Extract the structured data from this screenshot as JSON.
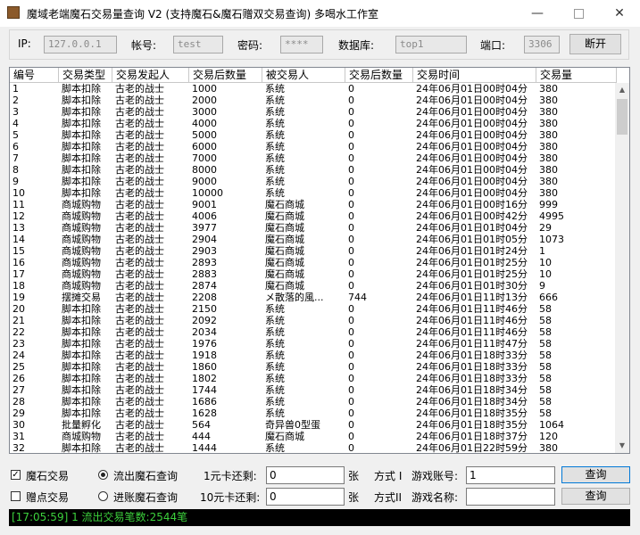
{
  "window": {
    "title": "魔域老端魔石交易量查询 V2 (支持魔石&魔石赠双交易查询) 多喝水工作室"
  },
  "connection": {
    "ip_label": "IP:",
    "ip_value": "127.0.0.1",
    "account_label": "帐号:",
    "account_value": "test",
    "password_label": "密码:",
    "password_value": "****",
    "database_label": "数据库:",
    "database_value": "top1",
    "port_label": "端口:",
    "port_value": "3306",
    "disconnect_label": "断开"
  },
  "table": {
    "columns": [
      "编号",
      "交易类型",
      "交易发起人",
      "交易后数量",
      "被交易人",
      "交易后数量",
      "交易时间",
      "交易量"
    ],
    "rows": [
      [
        "1",
        "脚本扣除",
        "古老的战士",
        "1000",
        "系统",
        "0",
        "24年06月01日00时04分",
        "380"
      ],
      [
        "2",
        "脚本扣除",
        "古老的战士",
        "2000",
        "系统",
        "0",
        "24年06月01日00时04分",
        "380"
      ],
      [
        "3",
        "脚本扣除",
        "古老的战士",
        "3000",
        "系统",
        "0",
        "24年06月01日00时04分",
        "380"
      ],
      [
        "4",
        "脚本扣除",
        "古老的战士",
        "4000",
        "系统",
        "0",
        "24年06月01日00时04分",
        "380"
      ],
      [
        "5",
        "脚本扣除",
        "古老的战士",
        "5000",
        "系统",
        "0",
        "24年06月01日00时04分",
        "380"
      ],
      [
        "6",
        "脚本扣除",
        "古老的战士",
        "6000",
        "系统",
        "0",
        "24年06月01日00时04分",
        "380"
      ],
      [
        "7",
        "脚本扣除",
        "古老的战士",
        "7000",
        "系统",
        "0",
        "24年06月01日00时04分",
        "380"
      ],
      [
        "8",
        "脚本扣除",
        "古老的战士",
        "8000",
        "系统",
        "0",
        "24年06月01日00时04分",
        "380"
      ],
      [
        "9",
        "脚本扣除",
        "古老的战士",
        "9000",
        "系统",
        "0",
        "24年06月01日00时04分",
        "380"
      ],
      [
        "10",
        "脚本扣除",
        "古老的战士",
        "10000",
        "系统",
        "0",
        "24年06月01日00时04分",
        "380"
      ],
      [
        "11",
        "商城购物",
        "古老的战士",
        "9001",
        "魔石商城",
        "0",
        "24年06月01日00时16分",
        "999"
      ],
      [
        "12",
        "商城购物",
        "古老的战士",
        "4006",
        "魔石商城",
        "0",
        "24年06月01日00时42分",
        "4995"
      ],
      [
        "13",
        "商城购物",
        "古老的战士",
        "3977",
        "魔石商城",
        "0",
        "24年06月01日01时04分",
        "29"
      ],
      [
        "14",
        "商城购物",
        "古老的战士",
        "2904",
        "魔石商城",
        "0",
        "24年06月01日01时05分",
        "1073"
      ],
      [
        "15",
        "商城购物",
        "古老的战士",
        "2903",
        "魔石商城",
        "0",
        "24年06月01日01时24分",
        "1"
      ],
      [
        "16",
        "商城购物",
        "古老的战士",
        "2893",
        "魔石商城",
        "0",
        "24年06月01日01时25分",
        "10"
      ],
      [
        "17",
        "商城购物",
        "古老的战士",
        "2883",
        "魔石商城",
        "0",
        "24年06月01日01时25分",
        "10"
      ],
      [
        "18",
        "商城购物",
        "古老的战士",
        "2874",
        "魔石商城",
        "0",
        "24年06月01日01时30分",
        "9"
      ],
      [
        "19",
        "摆摊交易",
        "古老的战士",
        "2208",
        "メ散落的風...",
        "744",
        "24年06月01日11时13分",
        "666"
      ],
      [
        "20",
        "脚本扣除",
        "古老的战士",
        "2150",
        "系统",
        "0",
        "24年06月01日11时46分",
        "58"
      ],
      [
        "21",
        "脚本扣除",
        "古老的战士",
        "2092",
        "系统",
        "0",
        "24年06月01日11时46分",
        "58"
      ],
      [
        "22",
        "脚本扣除",
        "古老的战士",
        "2034",
        "系统",
        "0",
        "24年06月01日11时46分",
        "58"
      ],
      [
        "23",
        "脚本扣除",
        "古老的战士",
        "1976",
        "系统",
        "0",
        "24年06月01日11时47分",
        "58"
      ],
      [
        "24",
        "脚本扣除",
        "古老的战士",
        "1918",
        "系统",
        "0",
        "24年06月01日18时33分",
        "58"
      ],
      [
        "25",
        "脚本扣除",
        "古老的战士",
        "1860",
        "系统",
        "0",
        "24年06月01日18时33分",
        "58"
      ],
      [
        "26",
        "脚本扣除",
        "古老的战士",
        "1802",
        "系统",
        "0",
        "24年06月01日18时33分",
        "58"
      ],
      [
        "27",
        "脚本扣除",
        "古老的战士",
        "1744",
        "系统",
        "0",
        "24年06月01日18时34分",
        "58"
      ],
      [
        "28",
        "脚本扣除",
        "古老的战士",
        "1686",
        "系统",
        "0",
        "24年06月01日18时34分",
        "58"
      ],
      [
        "29",
        "脚本扣除",
        "古老的战士",
        "1628",
        "系统",
        "0",
        "24年06月01日18时35分",
        "58"
      ],
      [
        "30",
        "批量孵化",
        "古老的战士",
        "564",
        "奇异兽0型蛋",
        "0",
        "24年06月01日18时35分",
        "1064"
      ],
      [
        "31",
        "商城购物",
        "古老的战士",
        "444",
        "魔石商城",
        "0",
        "24年06月01日18时37分",
        "120"
      ],
      [
        "32",
        "脚本扣除",
        "古老的战士",
        "1444",
        "系统",
        "0",
        "24年06月01日22时59分",
        "380"
      ]
    ]
  },
  "filters": {
    "magic_stone_label": "魔石交易",
    "magic_stone_checked": "✓",
    "gift_point_label": "赠点交易",
    "outflow_label": "流出魔石查询",
    "inflow_label": "进账魔石查询",
    "card1_label": "1元卡还剩:",
    "card1_value": "0",
    "card10_label": "10元卡还剩:",
    "card10_value": "0",
    "unit1": "张",
    "unit2": "张",
    "method1_label": "方式 I",
    "method2_label": "方式II",
    "game_account_label": "游戏账号:",
    "game_account_value": "1",
    "game_name_label": "游戏名称:",
    "game_name_value": "",
    "query_label": "查询",
    "query2_label": "查询"
  },
  "status": {
    "text": "[17:05:59] 1 流出交易笔数:2544笔"
  },
  "colors": {
    "status_bg": "#000000",
    "status_fg": "#3cd03c"
  }
}
